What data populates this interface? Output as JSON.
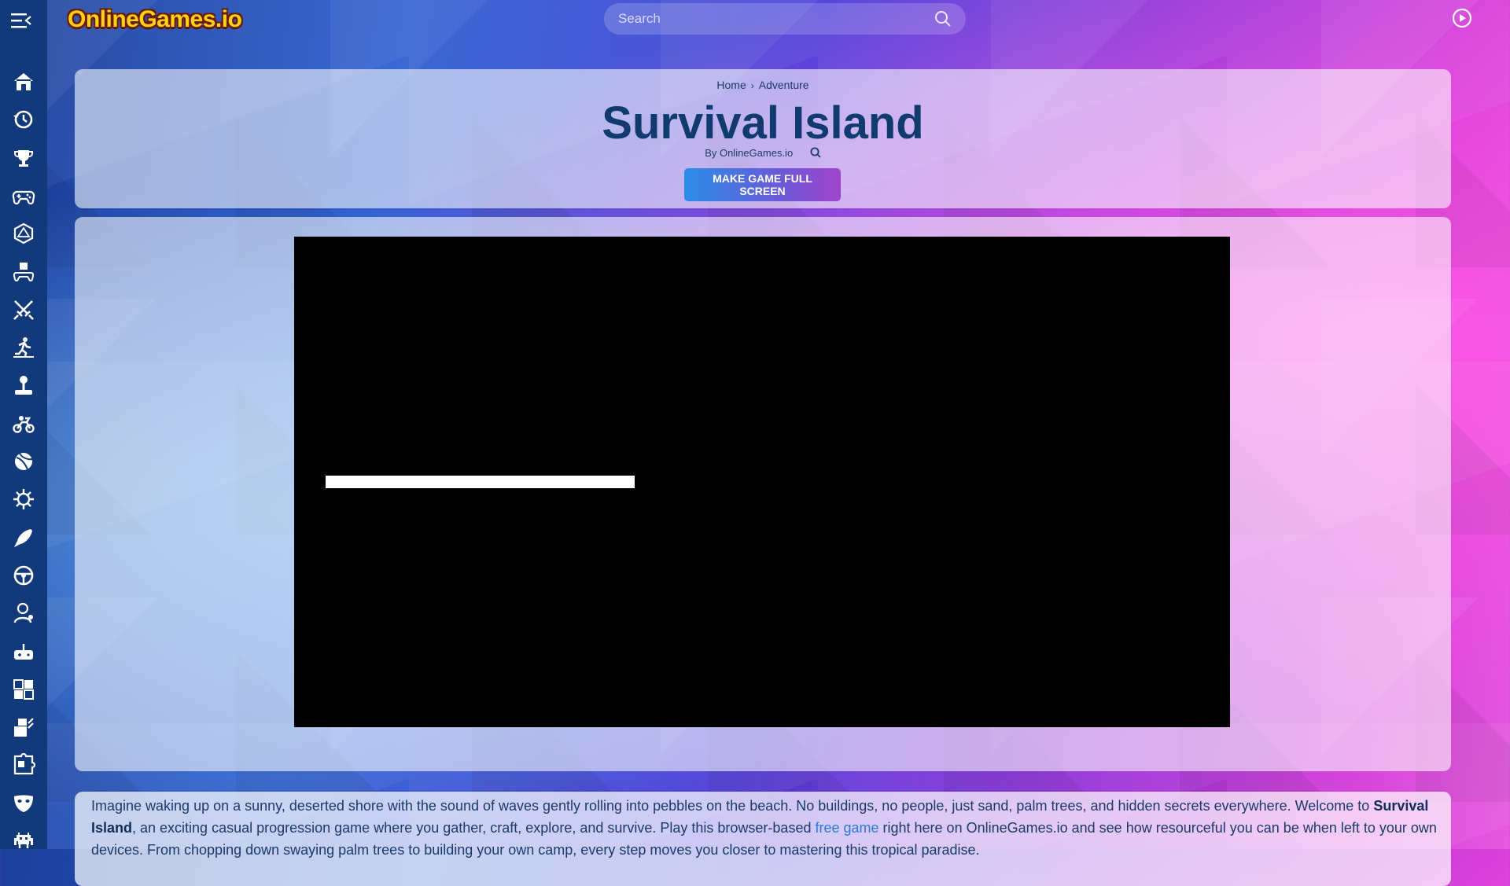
{
  "header": {
    "logo_text": "OnlineGames.io",
    "search_placeholder": "Search"
  },
  "sidebar": {
    "items": [
      {
        "icon": "home-icon"
      },
      {
        "icon": "history-icon"
      },
      {
        "icon": "trophy-icon"
      },
      {
        "icon": "gamepad-icon"
      },
      {
        "icon": "d20-dice-icon"
      },
      {
        "icon": "robot-controller-icon"
      },
      {
        "icon": "crossed-swords-icon"
      },
      {
        "icon": "runner-icon"
      },
      {
        "icon": "joystick-icon"
      },
      {
        "icon": "motorbike-icon"
      },
      {
        "icon": "ball-icon"
      },
      {
        "icon": "virus-icon"
      },
      {
        "icon": "rocket-icon"
      },
      {
        "icon": "steering-wheel-icon"
      },
      {
        "icon": "kids-icon"
      },
      {
        "icon": "retro-controller-icon"
      },
      {
        "icon": "tetris-icon"
      },
      {
        "icon": "building-blocks-icon"
      },
      {
        "icon": "puzzle-icon"
      },
      {
        "icon": "mask-icon"
      },
      {
        "icon": "space-invader-icon"
      }
    ]
  },
  "breadcrumb": {
    "home": "Home",
    "separator": "›",
    "category": "Adventure"
  },
  "game": {
    "title": "Survival Island",
    "byline": "By OnlineGames.io",
    "fullscreen_label": "MAKE GAME FULL SCREEN",
    "loading_progress": 0.33
  },
  "description": {
    "p1": "Imagine waking up on a sunny, deserted shore with the sound of waves gently rolling into pebbles on the beach. No buildings, no people, just sand, palm trees, and hidden secrets everywhere. Welcome to ",
    "game_name": "Survival Island",
    "p2": ", an exciting casual progression game where you gather, craft, explore, and survive. Play this browser-based ",
    "link_text": "free game",
    "p3": " right here on OnlineGames.io and see how resourceful you can be when left to your own devices. From chopping down swaying palm trees to building your own camp, every step moves you closer to mastering this tropical paradise."
  },
  "colors": {
    "sidebar_bg": "#123a7a",
    "title_color": "#113a6e",
    "link_color": "#2a7ad8",
    "logo_yellow": "#ffd21a"
  }
}
